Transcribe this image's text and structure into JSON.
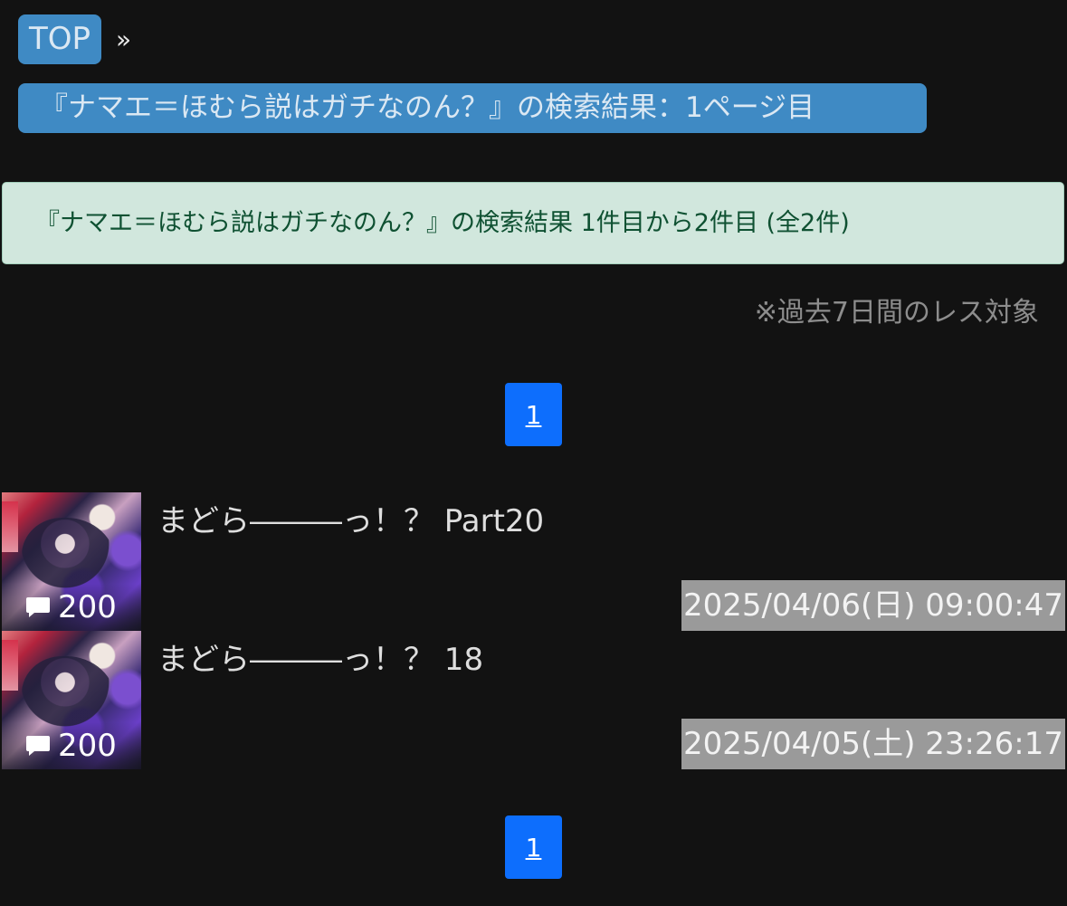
{
  "breadcrumb": {
    "top_label": "TOP",
    "separator": "»"
  },
  "page_title": "『ナマエ＝ほむら説はガチなのん？』の検索結果：1ページ目",
  "result_summary": "『ナマエ＝ほむら説はガチなのん？』の検索結果 1件目から2件目 (全2件)",
  "note": "※過去7日間のレス対象",
  "pagination": {
    "top": [
      "1"
    ],
    "bottom": [
      "1"
    ]
  },
  "threads": [
    {
      "title": "まどら―――っ！？ Part20",
      "comment_count": "200",
      "datetime": "2025/04/06(日) 09:00:47",
      "thumb_icon": "comment-icon"
    },
    {
      "title": "まどら―――っ！？ 18",
      "comment_count": "200",
      "datetime": "2025/04/05(土) 23:26:17",
      "thumb_icon": "comment-icon"
    }
  ],
  "colors": {
    "background": "#121212",
    "pill": "#3f8ac4",
    "alert_bg": "#d1e7dd",
    "alert_text": "#0f5132",
    "pager": "#0d6efd",
    "date_bg": "#9a9a9a"
  }
}
